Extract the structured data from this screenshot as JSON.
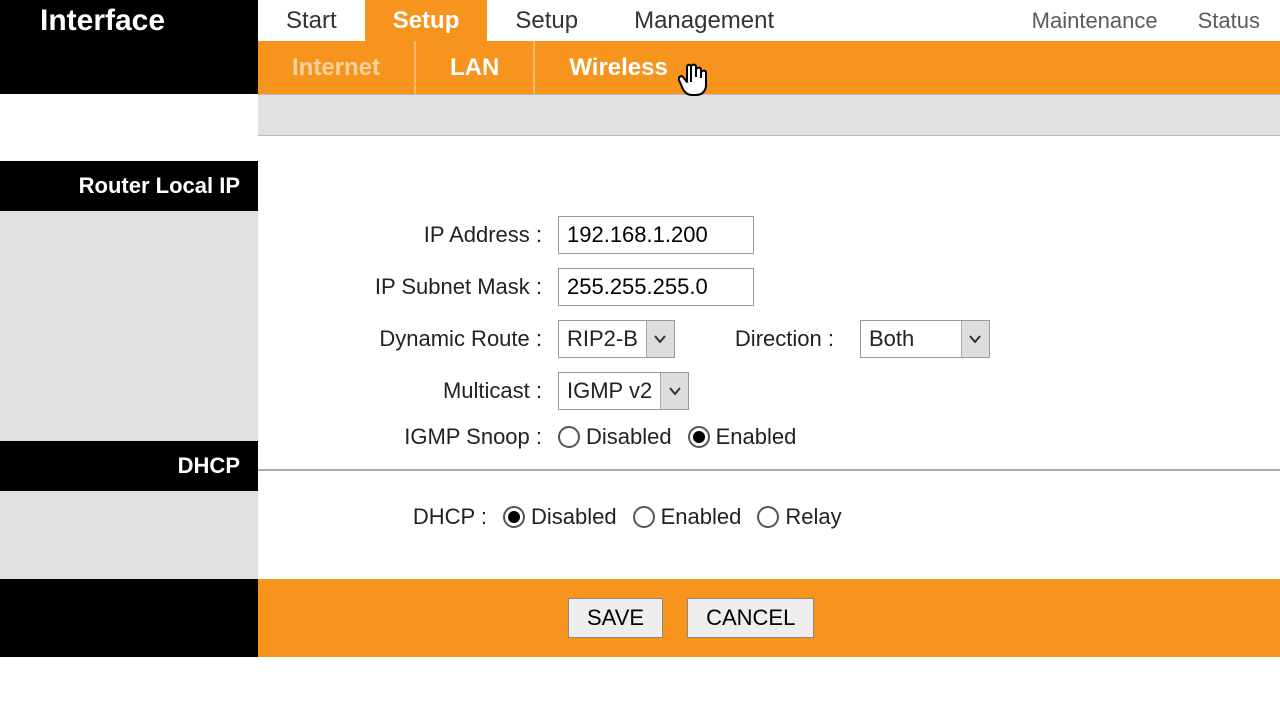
{
  "brand": "Interface",
  "top_tabs": {
    "start": "Start",
    "setup1": "Setup",
    "setup2": "Setup",
    "management": "Management",
    "maintenance": "Maintenance",
    "status": "Status"
  },
  "sub_tabs": {
    "internet": "Internet",
    "lan": "LAN",
    "wireless": "Wireless"
  },
  "sections": {
    "router_local_ip": "Router Local IP",
    "dhcp": "DHCP"
  },
  "labels": {
    "ip_address": "IP Address :",
    "subnet": "IP Subnet Mask :",
    "dynamic_route": "Dynamic Route :",
    "direction": "Direction :",
    "multicast": "Multicast :",
    "igmp_snoop": "IGMP Snoop :",
    "dhcp": "DHCP :"
  },
  "values": {
    "ip_address": "192.168.1.200",
    "subnet": "255.255.255.0",
    "dynamic_route": "RIP2-B",
    "direction": "Both",
    "multicast": "IGMP v2"
  },
  "options": {
    "disabled": "Disabled",
    "enabled": "Enabled",
    "relay": "Relay"
  },
  "buttons": {
    "save": "SAVE",
    "cancel": "CANCEL"
  }
}
